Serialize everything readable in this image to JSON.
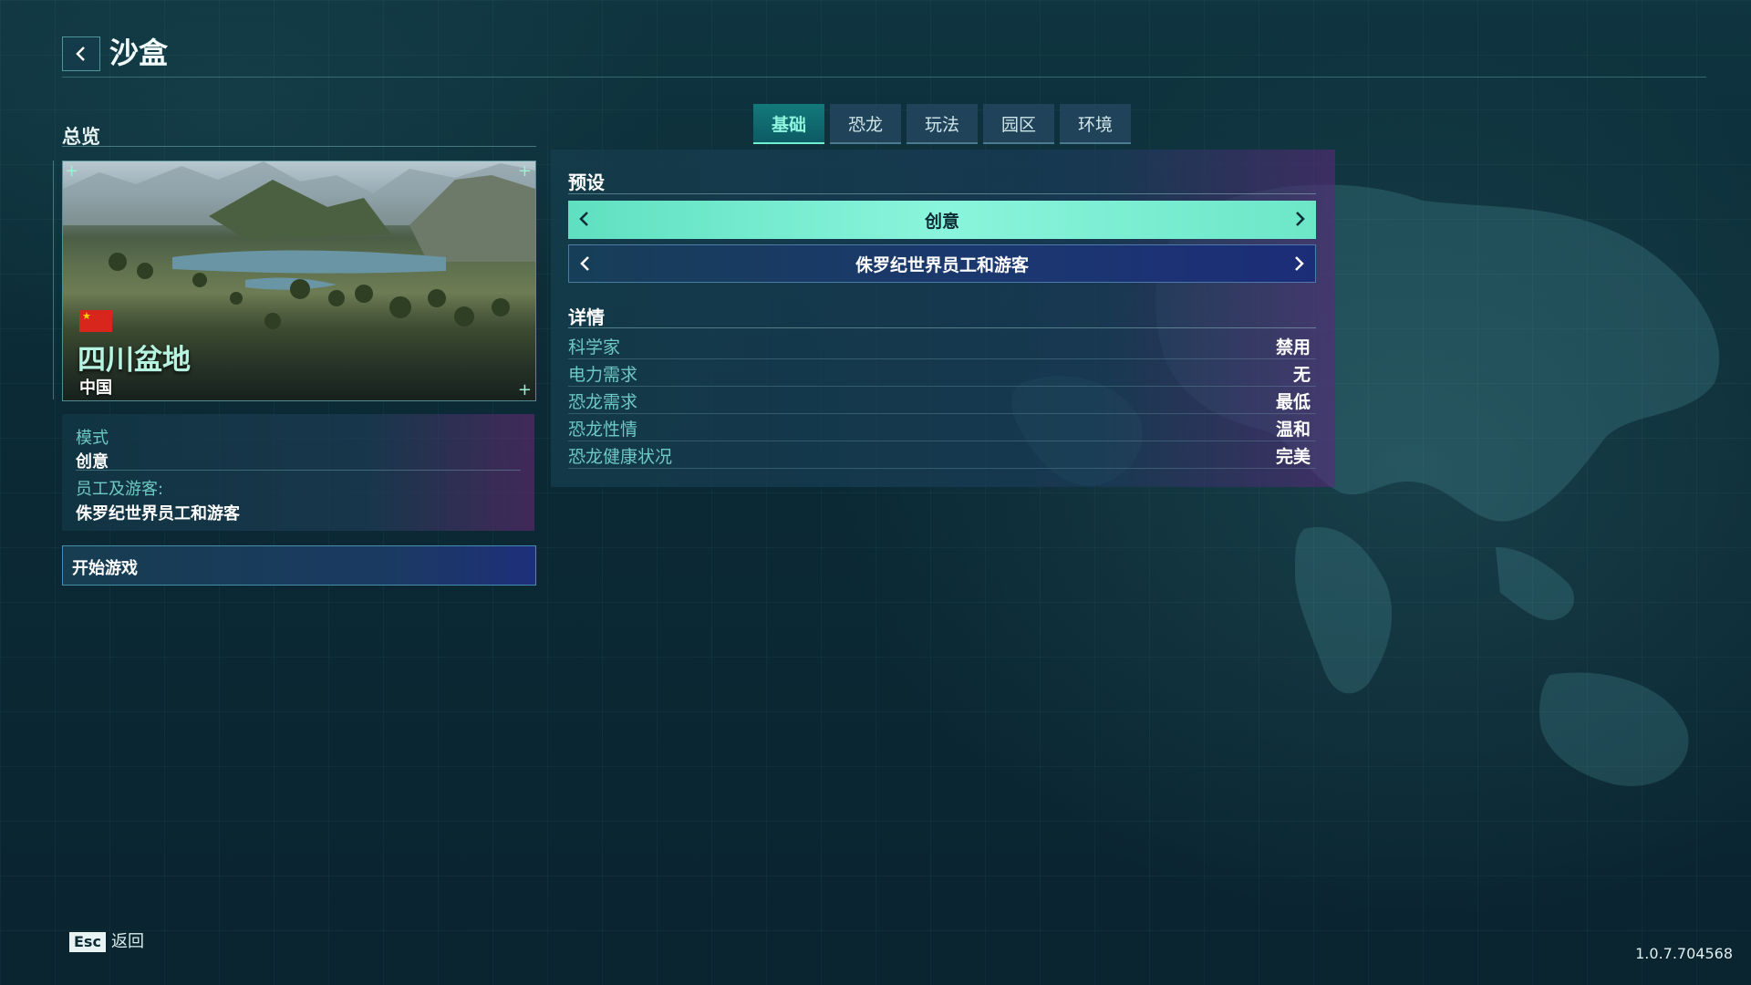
{
  "header": {
    "title": "沙盒"
  },
  "left_panel": {
    "section_title": "总览",
    "map": {
      "name": "四川盆地",
      "country": "中国",
      "flag": "china-flag-icon"
    },
    "overview": {
      "mode_label": "模式",
      "mode_value": "创意",
      "staff_label": "员工及游客:",
      "staff_value": "侏罗纪世界员工和游客"
    },
    "start_button": "开始游戏"
  },
  "tabs": [
    {
      "label": "基础",
      "active": true
    },
    {
      "label": "恐龙",
      "active": false
    },
    {
      "label": "玩法",
      "active": false
    },
    {
      "label": "园区",
      "active": false
    },
    {
      "label": "环境",
      "active": false
    }
  ],
  "settings": {
    "preset_title": "预设",
    "presets": [
      "创意",
      "侏罗纪世界员工和游客"
    ],
    "details_title": "详情",
    "details": [
      {
        "label": "科学家",
        "value": "禁用"
      },
      {
        "label": "电力需求",
        "value": "无"
      },
      {
        "label": "恐龙需求",
        "value": "最低"
      },
      {
        "label": "恐龙性情",
        "value": "温和"
      },
      {
        "label": "恐龙健康状况",
        "value": "完美"
      }
    ]
  },
  "footer": {
    "esc_key": "Esc",
    "esc_label": "返回",
    "version": "1.0.7.704568"
  },
  "colors": {
    "accent": "#6ff0d0",
    "title_green": "#b6f3e0",
    "label_teal": "#6ec8c4"
  }
}
